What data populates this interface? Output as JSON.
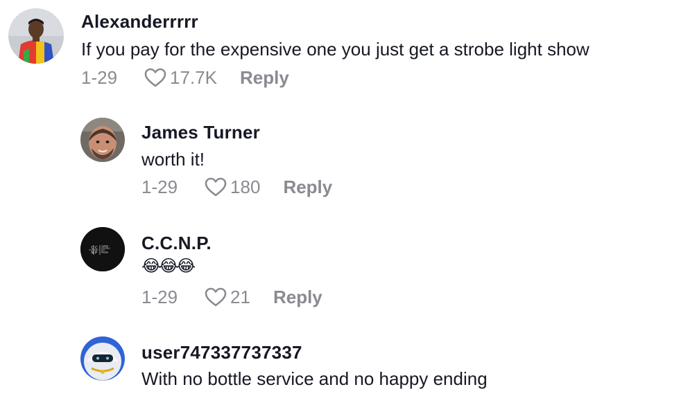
{
  "comments": [
    {
      "username": "Alexanderrrrr",
      "text": "If you pay for the expensive one you just get a strobe light show",
      "date": "1-29",
      "likes": "17.7K",
      "reply_label": "Reply"
    },
    {
      "username": "James Turner",
      "text": "worth it!",
      "date": "1-29",
      "likes": "180",
      "reply_label": "Reply"
    },
    {
      "username": "C.C.N.P.",
      "text": "😂😂😂",
      "date": "1-29",
      "likes": "21",
      "reply_label": "Reply",
      "avatar_logo": {
        "letters": [
          "C",
          "C",
          "N",
          "P"
        ],
        "tagline": [
          "CHARGE",
          "CRYSTALS",
          "NOT",
          "PHONES"
        ]
      }
    },
    {
      "username": "user747337737337",
      "text": "With no bottle service and no happy ending"
    }
  ],
  "colors": {
    "text": "#161823",
    "muted": "#8a8b91",
    "background": "#ffffff"
  },
  "icons": {
    "like": "heart-outline-icon"
  }
}
